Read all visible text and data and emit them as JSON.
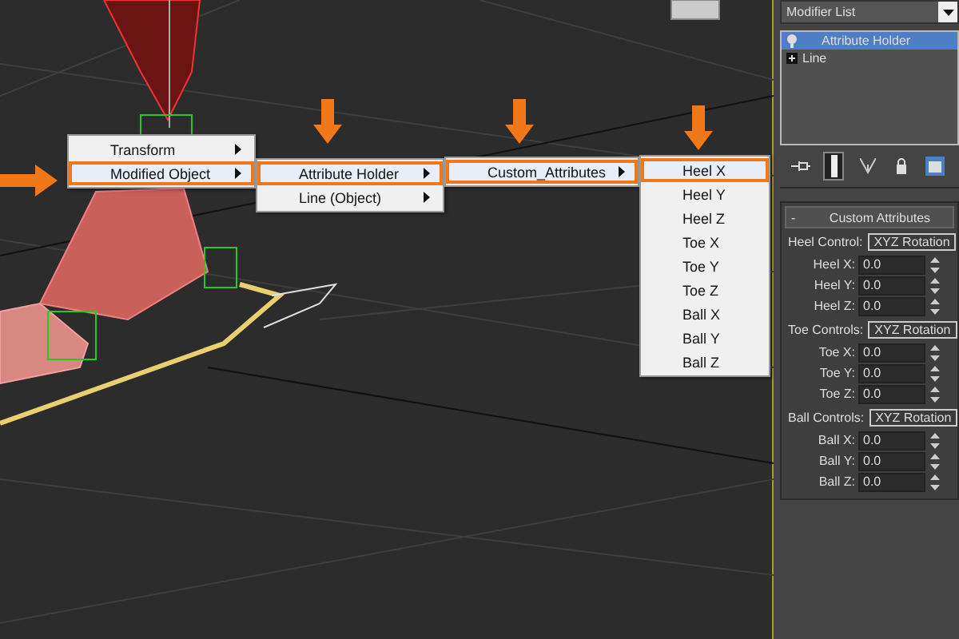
{
  "menus": [
    {
      "items": [
        {
          "label": "Transform",
          "selected": false,
          "submenu": true
        },
        {
          "label": "Modified Object",
          "selected": true,
          "submenu": true
        }
      ]
    },
    {
      "items": [
        {
          "label": "Attribute Holder",
          "selected": true,
          "submenu": true
        },
        {
          "label": "Line (Object)",
          "selected": false,
          "submenu": true
        }
      ]
    },
    {
      "items": [
        {
          "label": "Custom_Attributes",
          "selected": true,
          "submenu": true
        }
      ]
    },
    {
      "items": [
        {
          "label": "Heel X",
          "selected": true,
          "submenu": false
        },
        {
          "label": "Heel Y",
          "selected": false,
          "submenu": false
        },
        {
          "label": "Heel Z",
          "selected": false,
          "submenu": false
        },
        {
          "label": "Toe X",
          "selected": false,
          "submenu": false
        },
        {
          "label": "Toe Y",
          "selected": false,
          "submenu": false
        },
        {
          "label": "Toe Z",
          "selected": false,
          "submenu": false
        },
        {
          "label": "Ball X",
          "selected": false,
          "submenu": false
        },
        {
          "label": "Ball Y",
          "selected": false,
          "submenu": false
        },
        {
          "label": "Ball Z",
          "selected": false,
          "submenu": false
        }
      ]
    }
  ],
  "modifier_list": {
    "label": "Modifier List"
  },
  "stack": [
    {
      "label": "Attribute Holder",
      "kind": "modifier",
      "selected": true
    },
    {
      "label": "Line",
      "kind": "object",
      "selected": false
    }
  ],
  "toolbar": [
    {
      "kind": "pin",
      "selected": false
    },
    {
      "kind": "bar",
      "selected": true
    },
    {
      "kind": "fork",
      "selected": false
    },
    {
      "kind": "lock",
      "selected": false
    },
    {
      "kind": "config",
      "selected": false
    }
  ],
  "rollout": {
    "sign": "-",
    "title": "Custom Attributes"
  },
  "groups": [
    {
      "label": "Heel Control:",
      "mode": "XYZ Rotation",
      "fields": [
        {
          "label": "Heel X:",
          "value": "0.0"
        },
        {
          "label": "Heel Y:",
          "value": "0.0"
        },
        {
          "label": "Heel Z:",
          "value": "0.0"
        }
      ]
    },
    {
      "label": "Toe Controls:",
      "mode": "XYZ Rotation",
      "fields": [
        {
          "label": "Toe X:",
          "value": "0.0"
        },
        {
          "label": "Toe Y:",
          "value": "0.0"
        },
        {
          "label": "Toe Z:",
          "value": "0.0"
        }
      ]
    },
    {
      "label": "Ball Controls:",
      "mode": "XYZ Rotation",
      "fields": [
        {
          "label": "Ball X:",
          "value": "0.0"
        },
        {
          "label": "Ball Y:",
          "value": "0.0"
        },
        {
          "label": "Ball Z:",
          "value": "0.0"
        }
      ]
    }
  ]
}
